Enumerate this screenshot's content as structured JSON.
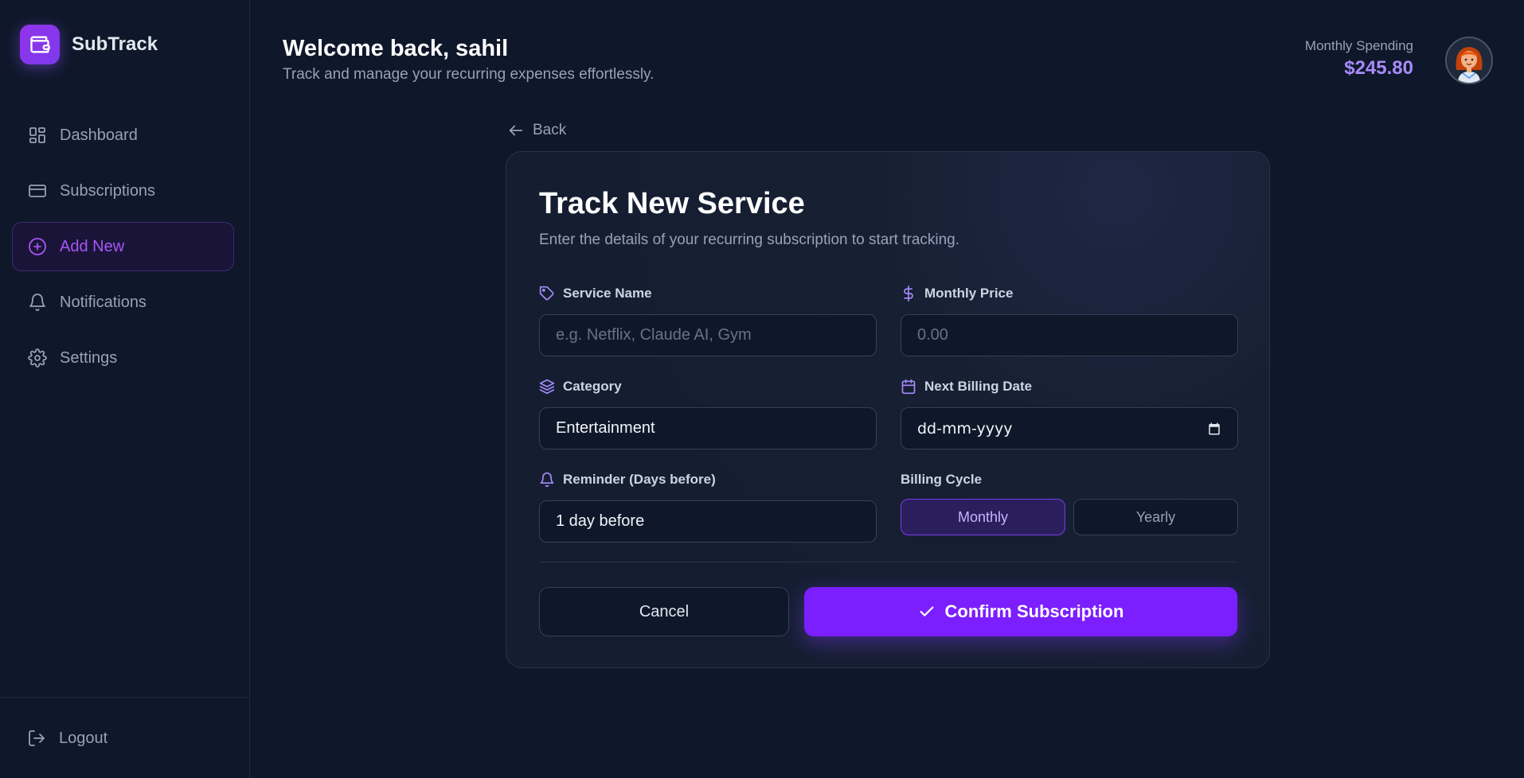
{
  "brand": {
    "name": "SubTrack",
    "logo_icon": "wallet-icon",
    "accent": "#7c3aed"
  },
  "sidebar": {
    "items": [
      {
        "label": "Dashboard",
        "icon": "dashboard-icon"
      },
      {
        "label": "Subscriptions",
        "icon": "credit-card-icon"
      },
      {
        "label": "Add New",
        "icon": "plus-circle-icon",
        "active": true
      },
      {
        "label": "Notifications",
        "icon": "bell-icon"
      },
      {
        "label": "Settings",
        "icon": "gear-icon"
      }
    ],
    "logout_label": "Logout"
  },
  "header": {
    "title": "Welcome back, sahil",
    "subtitle": "Track and manage your recurring expenses effortlessly.",
    "spending_label": "Monthly Spending",
    "spending_value": "$245.80"
  },
  "back_label": "Back",
  "form": {
    "title": "Track New Service",
    "subtitle": "Enter the details of your recurring subscription to start tracking.",
    "service_name": {
      "label": "Service Name",
      "placeholder": "e.g. Netflix, Claude AI, Gym",
      "value": ""
    },
    "monthly_price": {
      "label": "Monthly Price",
      "placeholder": "0.00",
      "value": ""
    },
    "category": {
      "label": "Category",
      "value": "Entertainment"
    },
    "next_billing_date": {
      "label": "Next Billing Date",
      "value": "dd-mm-yyyy"
    },
    "reminder": {
      "label": "Reminder (Days before)",
      "value": "1 day before"
    },
    "billing_cycle": {
      "label": "Billing Cycle",
      "options": [
        "Monthly",
        "Yearly"
      ],
      "selected": "Monthly"
    },
    "cancel_label": "Cancel",
    "confirm_label": "Confirm Subscription"
  }
}
